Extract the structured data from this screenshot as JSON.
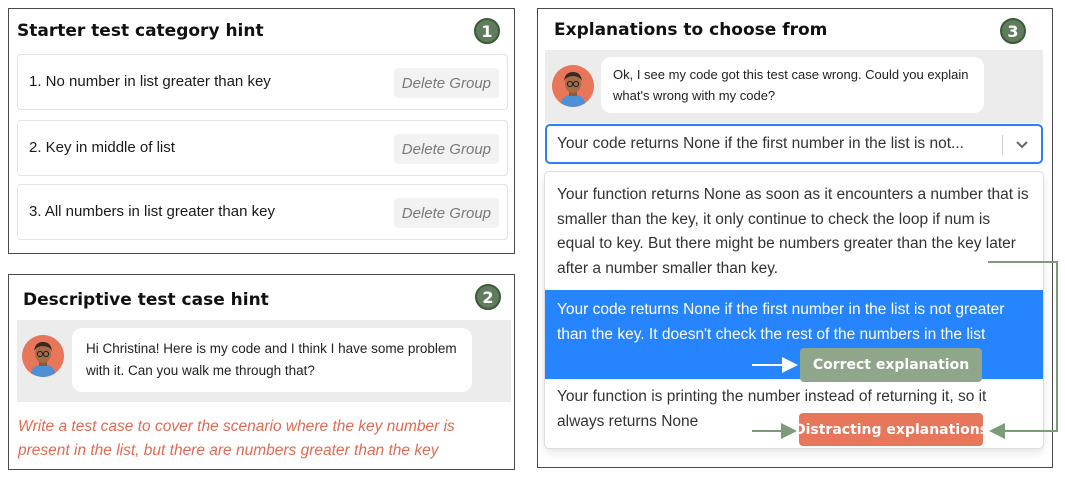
{
  "panel1": {
    "title": "Starter test category hint",
    "badge": "1",
    "groups": [
      {
        "label": "1. No number in list greater than key",
        "button": "Delete Group"
      },
      {
        "label": "2. Key in middle of list",
        "button": "Delete Group"
      },
      {
        "label": "3. All numbers in list greater than key",
        "button": "Delete Group"
      }
    ]
  },
  "panel2": {
    "title": "Descriptive test case hint",
    "badge": "2",
    "message": "Hi Christina! Here is my code and I think I have some problem with it. Can you walk me through that?",
    "hint": "Write a test case to cover the scenario where the key number is present in the list, but there are numbers greater than the key"
  },
  "panel3": {
    "title": "Explanations to choose from",
    "badge": "3",
    "message": "Ok, I see my code got this test case wrong. Could you explain what's wrong with my code?",
    "selected_value": "Your code returns None if the first number in the list is not...",
    "options": [
      "Your function returns None as soon as it encounters a number that is smaller than the key, it only continue to check the loop if num is equal to key. But there might be numbers greater than the key later after a number smaller than key.",
      "Your code returns None if the first number in the list is not greater than the key. It doesn't check the rest of the numbers in the list",
      "Your function is printing the number instead of returning it, so it always returns None"
    ]
  },
  "annotations": {
    "correct": "Correct explanation",
    "distracting": "Distracting explanations"
  },
  "colors": {
    "badge": "#5f7d5c",
    "hint_text": "#e06a52",
    "selected_option": "#2684ff",
    "correct_tag": "#8fa68b",
    "distract_tag": "#e8765a",
    "arrow": "#7d9a79"
  }
}
